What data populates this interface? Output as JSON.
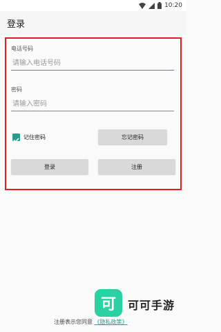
{
  "status_bar": {
    "time": "10:20",
    "icons": [
      "wifi-icon",
      "signal-icon",
      "battery-icon"
    ]
  },
  "app_bar": {
    "title": "登录"
  },
  "form": {
    "phone": {
      "label": "电话号码",
      "placeholder": "请输入电话号码",
      "value": ""
    },
    "password": {
      "label": "密码",
      "placeholder": "请输入密码",
      "value": ""
    },
    "remember": {
      "label": "记住密码",
      "checked": true
    },
    "forgot_button": "忘记密码",
    "login_button": "登录",
    "register_button": "注册"
  },
  "brand": {
    "logo_char": "可",
    "name": "可可手游"
  },
  "footer": {
    "text": "注册表示您同意",
    "link": "《隐私政策》"
  },
  "colors": {
    "accent": "#2b9c8d",
    "highlight_border": "#e31b23",
    "brand_logo": "#2ad1a3"
  }
}
